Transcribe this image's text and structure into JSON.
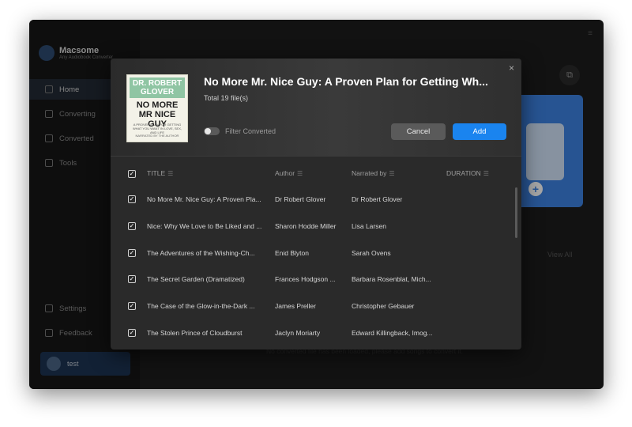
{
  "app": {
    "name": "Macsome",
    "subtitle": "Any Audiobook Converter"
  },
  "sidebar": {
    "items": [
      {
        "label": "Home"
      },
      {
        "label": "Converting"
      },
      {
        "label": "Converted"
      },
      {
        "label": "Tools"
      },
      {
        "label": "Settings"
      },
      {
        "label": "Feedback"
      }
    ],
    "user": "test"
  },
  "background": {
    "view_all": "View All",
    "tip": "No converted file has been loaded, please add songs to convert it."
  },
  "dialog": {
    "book_title": "No More Mr. Nice Guy: A Proven Plan for Getting Wh...",
    "total": "Total 19 file(s)",
    "filter_label": "Filter Converted",
    "filter_on": false,
    "cancel_label": "Cancel",
    "add_label": "Add",
    "close_label": "×",
    "cover": {
      "top": "DR. ROBERT GLOVER",
      "middle": "NO MORE MR NICE GUY",
      "sub": "A PROVEN PLAN FOR GETTING WHAT YOU WANT IN LOVE, SEX, AND LIFE",
      "foot": "NARRATED BY THE AUTHOR"
    },
    "columns": {
      "title": "TITLE",
      "author": "Author",
      "narrated": "Narrated by",
      "duration": "DURATION"
    },
    "rows": [
      {
        "title": "No More Mr. Nice Guy: A Proven Pla...",
        "author": "Dr Robert Glover",
        "narrated": "Dr Robert Glover",
        "checked": true
      },
      {
        "title": "Nice: Why We Love to Be Liked and ...",
        "author": "Sharon Hodde Miller",
        "narrated": "Lisa Larsen",
        "checked": true
      },
      {
        "title": "The Adventures of the Wishing-Ch...",
        "author": "Enid Blyton",
        "narrated": "Sarah Ovens",
        "checked": true
      },
      {
        "title": "The Secret Garden (Dramatized)",
        "author": "Frances Hodgson ...",
        "narrated": "Barbara Rosenblat, Mich...",
        "checked": true
      },
      {
        "title": "The Case of the Glow-in-the-Dark ...",
        "author": "James Preller",
        "narrated": "Christopher Gebauer",
        "checked": true
      },
      {
        "title": "The Stolen Prince of Cloudburst",
        "author": "Jaclyn Moriarty",
        "narrated": "Edward Killingback, Imog...",
        "checked": true
      }
    ]
  },
  "colors": {
    "accent": "#1a84ef",
    "window_bg": "#1c1c1c",
    "dialog_bg": "#2a2a2a"
  }
}
